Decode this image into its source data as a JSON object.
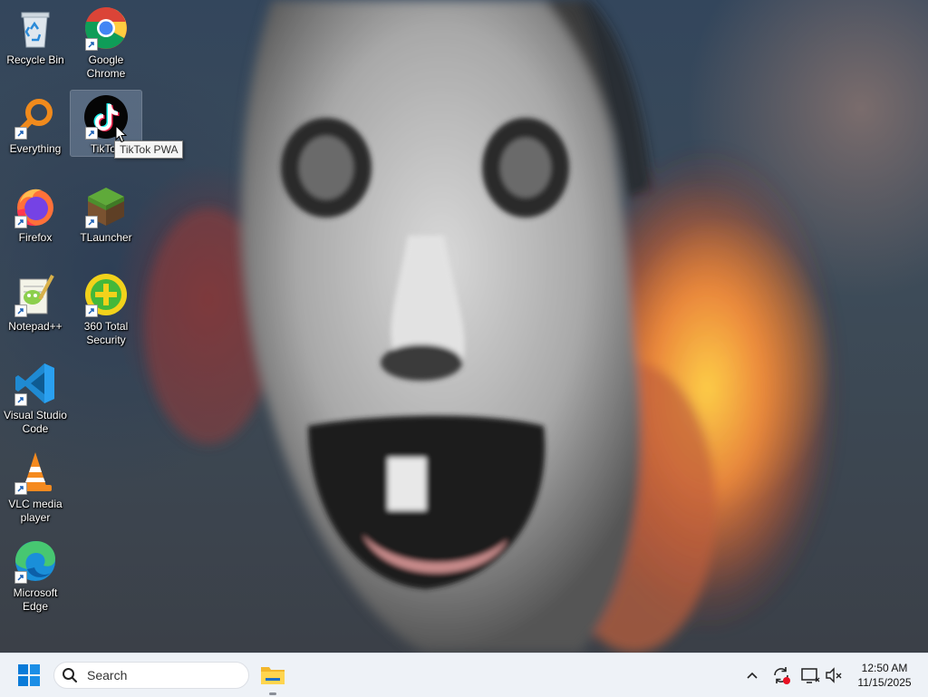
{
  "desktop": {
    "icons": [
      {
        "id": "recycle-bin",
        "label": "Recycle Bin"
      },
      {
        "id": "google-chrome",
        "label": "Google Chrome"
      },
      {
        "id": "everything",
        "label": "Everything"
      },
      {
        "id": "tiktok",
        "label": "TikTok"
      },
      {
        "id": "firefox",
        "label": "Firefox"
      },
      {
        "id": "tlauncher",
        "label": "TLauncher"
      },
      {
        "id": "notepad-plus-plus",
        "label": "Notepad++"
      },
      {
        "id": "360-total-security",
        "label": "360 Total Security"
      },
      {
        "id": "visual-studio-code",
        "label": "Visual Studio Code"
      },
      {
        "id": "vlc-media-player",
        "label": "VLC media player"
      },
      {
        "id": "microsoft-edge",
        "label": "Microsoft Edge"
      }
    ],
    "selected_icon": "tiktok",
    "tooltip": "TikTok PWA"
  },
  "taskbar": {
    "search_placeholder": "Search",
    "pinned": [
      {
        "id": "file-explorer",
        "icon": "folder-icon"
      }
    ],
    "tray": [
      {
        "id": "show-hidden-icons",
        "icon": "chevron-up-icon"
      },
      {
        "id": "update",
        "icon": "sync-icon"
      },
      {
        "id": "network",
        "icon": "monitor-icon"
      },
      {
        "id": "volume",
        "icon": "speaker-muted-icon"
      }
    ],
    "clock": {
      "time": "12:50 AM",
      "date": "11/15/2025"
    }
  }
}
